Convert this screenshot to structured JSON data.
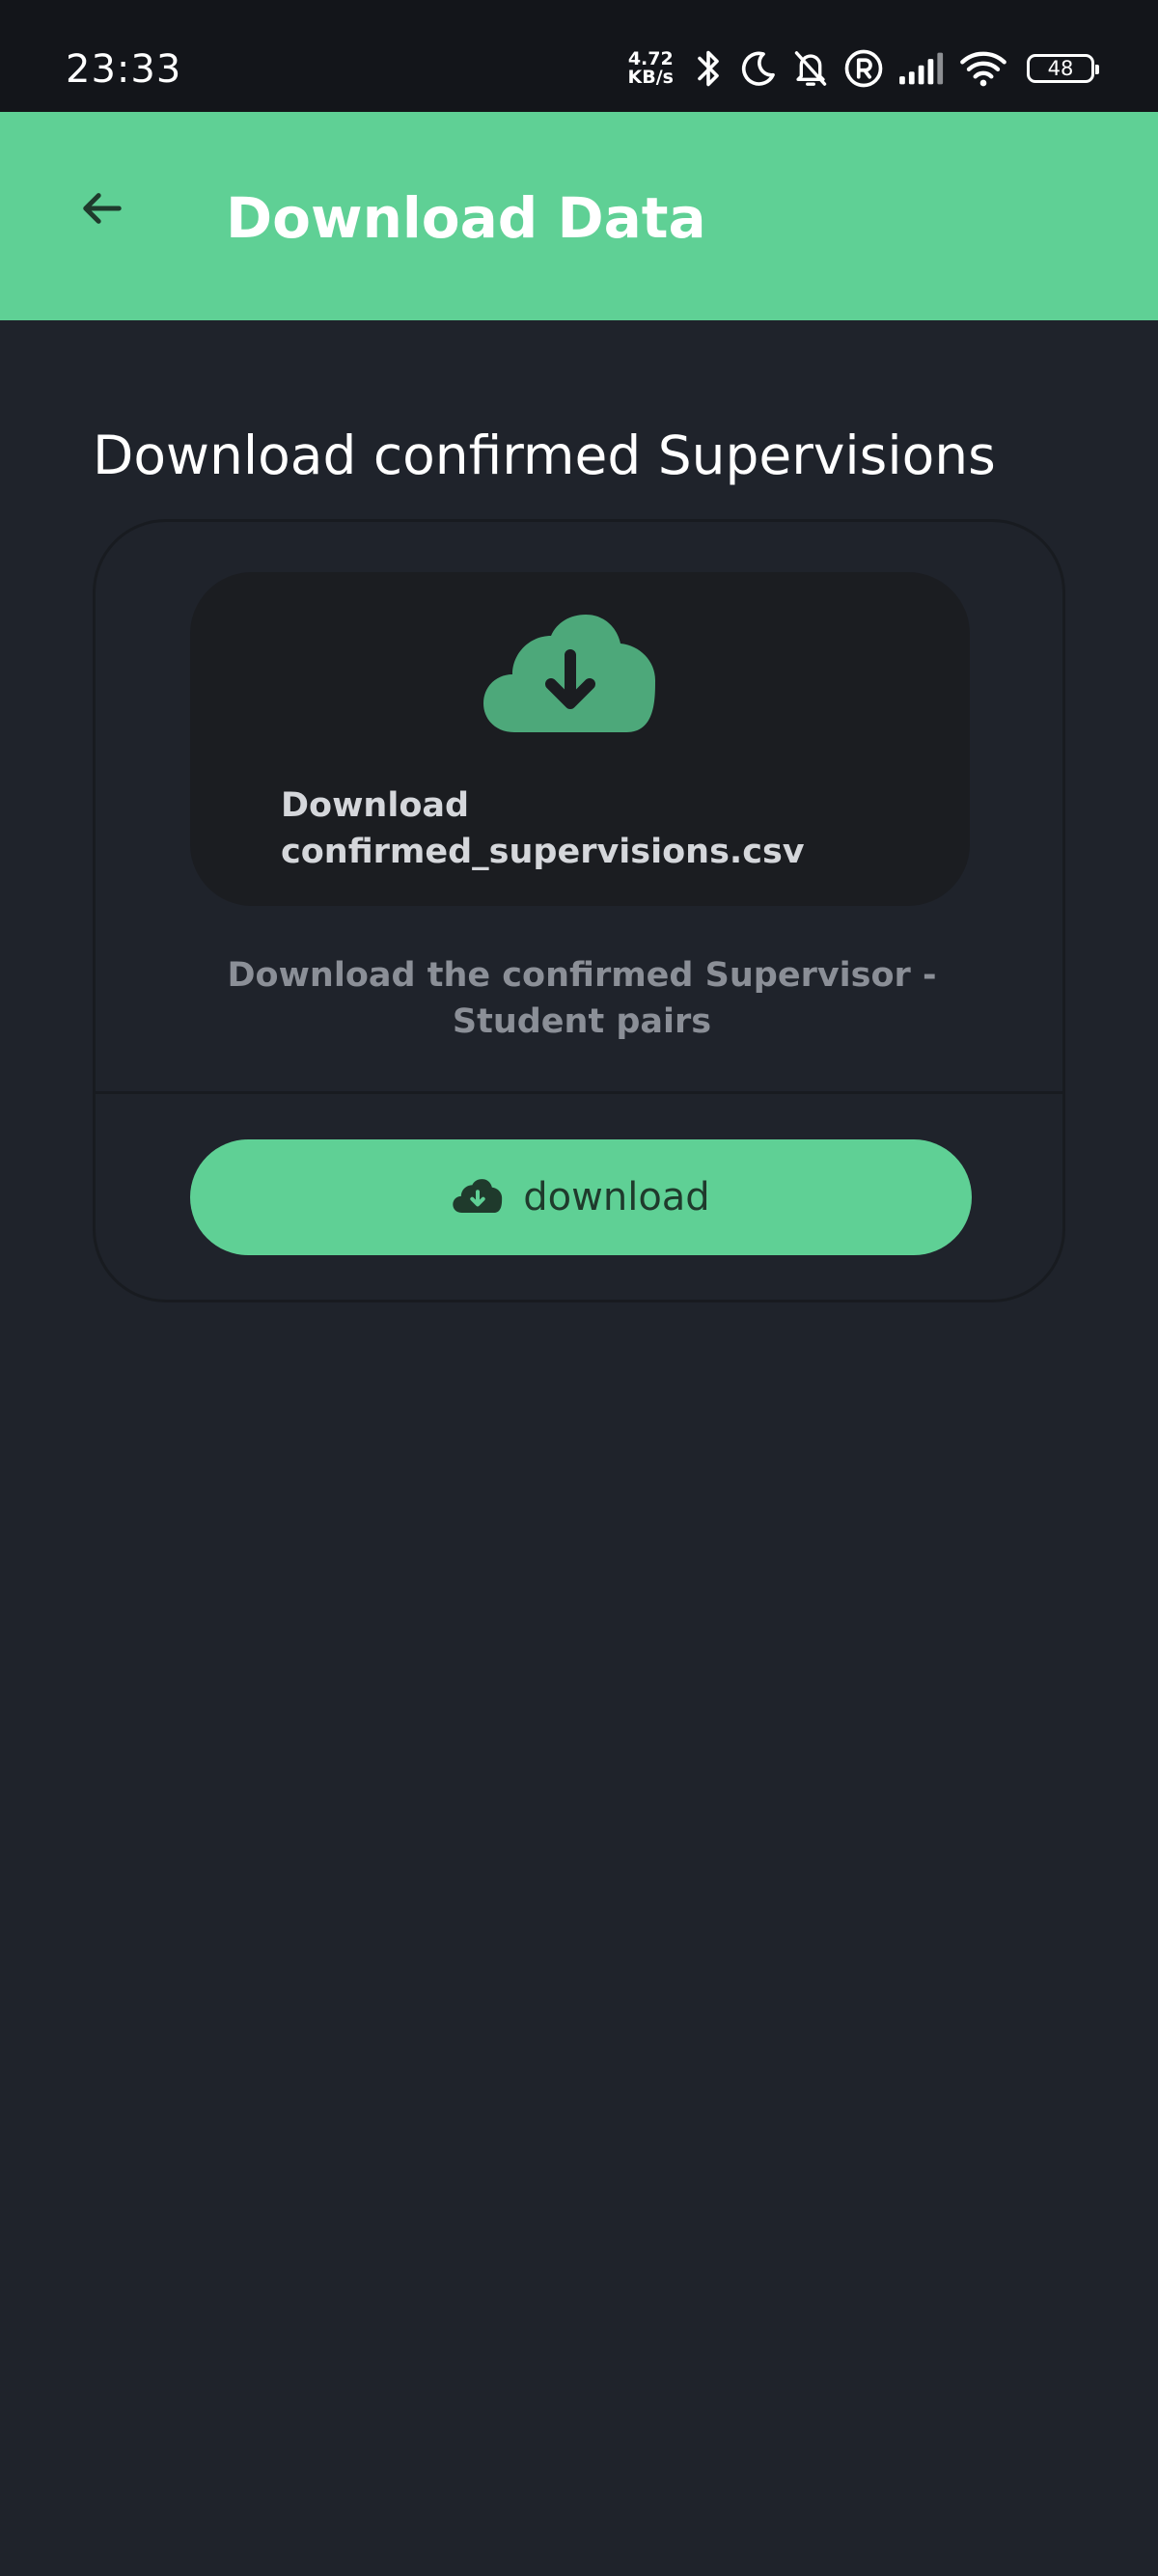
{
  "status_bar": {
    "time": "23:33",
    "net_speed_value": "4.72",
    "net_speed_unit": "KB/s",
    "battery_level": "48"
  },
  "app_bar": {
    "title": "Download Data",
    "back_icon": "arrow-left-icon"
  },
  "main": {
    "section_title": "Download confirmed Supervisions",
    "card": {
      "file_label_line1": "Download",
      "file_label_line2": "confirmed_supervisions.csv",
      "file_icon": "cloud-download-icon",
      "description": "Download the confirmed Supervisor - Student pairs",
      "button_label": "download",
      "button_icon": "cloud-download-icon"
    }
  },
  "colors": {
    "accent": "#5fd095",
    "background": "#1f232b",
    "status_bar": "#13151a",
    "tile": "#1b1d21",
    "icon_green": "#4da87a"
  }
}
